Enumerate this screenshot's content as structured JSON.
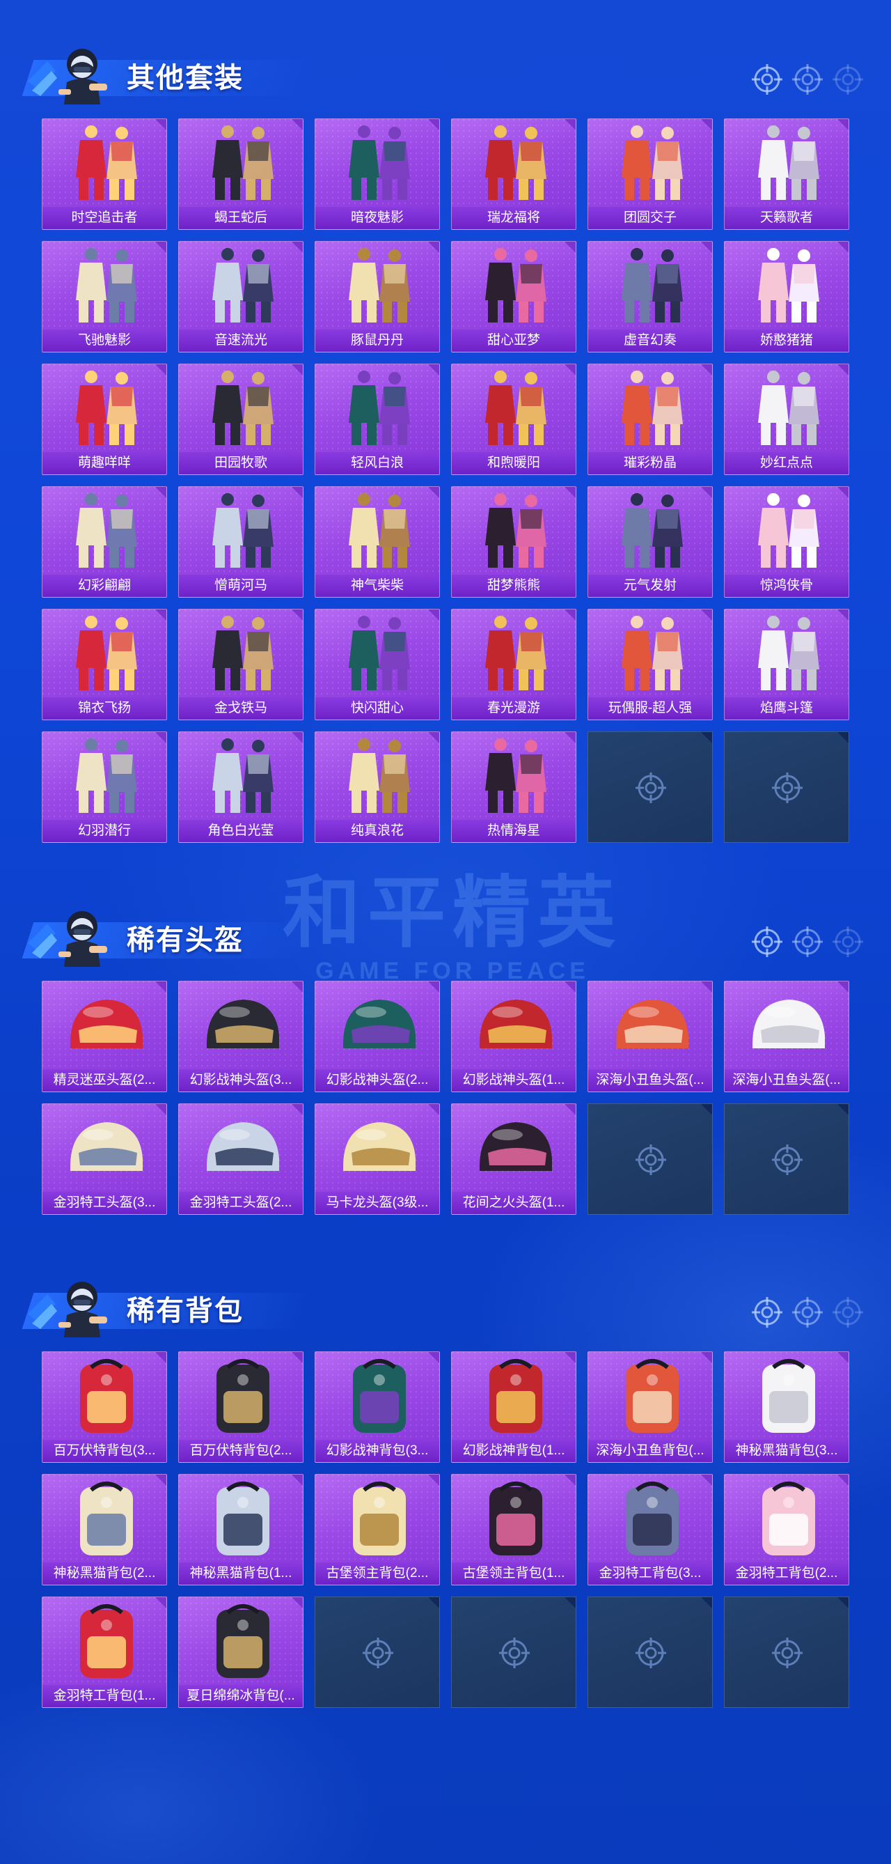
{
  "colors": {
    "background": "#1148d4",
    "card_purple": "#9a48e6",
    "card_label": "#7a2fd4",
    "empty_slot": "#1f3b66",
    "title_text": "#ffffff"
  },
  "watermark": {
    "title": "和平精英",
    "subtitle": "GAME FOR PEACE"
  },
  "sections": {
    "outfits": {
      "title": "其他套装",
      "items": [
        {
          "label": "时空追击者",
          "art": "red-armor-suit"
        },
        {
          "label": "蝎王蛇后",
          "art": "dark-gold-suits"
        },
        {
          "label": "暗夜魅影",
          "art": "teal-dark-suits"
        },
        {
          "label": "瑞龙福将",
          "art": "red-gold-suits"
        },
        {
          "label": "团圆交子",
          "art": "orange-red-dresses"
        },
        {
          "label": "天籁歌者",
          "art": "white-suits"
        },
        {
          "label": "飞驰魅影",
          "art": "gold-white-suits"
        },
        {
          "label": "音速流光",
          "art": "silver-jacket-suits"
        },
        {
          "label": "豚鼠丹丹",
          "art": "cream-costume"
        },
        {
          "label": "甜心亚梦",
          "art": "pink-black-outfit"
        },
        {
          "label": "虚音幻奏",
          "art": "gray-purple-suits"
        },
        {
          "label": "娇憨猪猪",
          "art": "pink-piggy-outfit"
        },
        {
          "label": "萌趣咩咩",
          "art": "blue-sheep-outfit"
        },
        {
          "label": "田园牧歌",
          "art": "yellow-pastoral-outfit"
        },
        {
          "label": "轻风白浪",
          "art": "white-breeze-outfit"
        },
        {
          "label": "和煦暖阳",
          "art": "white-pink-outfit"
        },
        {
          "label": "璀彩粉晶",
          "art": "pink-crystal-outfit"
        },
        {
          "label": "妙红点点",
          "art": "red-dot-dress"
        },
        {
          "label": "幻彩翩翩",
          "art": "rainbow-outfit"
        },
        {
          "label": "憎萌河马",
          "art": "mint-hippo-outfit"
        },
        {
          "label": "神气柴柴",
          "art": "orange-shiba-outfit"
        },
        {
          "label": "甜梦熊熊",
          "art": "blue-bear-outfit"
        },
        {
          "label": "元气发射",
          "art": "white-sport-outfit"
        },
        {
          "label": "惊鸿侠骨",
          "art": "dark-red-robes"
        },
        {
          "label": "锦衣飞扬",
          "art": "white-blue-robes"
        },
        {
          "label": "金戈铁马",
          "art": "black-gold-robes"
        },
        {
          "label": "快闪甜心",
          "art": "black-pink-heart-outfit"
        },
        {
          "label": "春光漫游",
          "art": "black-pink-jacket"
        },
        {
          "label": "玩偶服-超人强",
          "art": "superhero-mascot-suits"
        },
        {
          "label": "焰鹰斗篷",
          "art": "black-red-cloak"
        },
        {
          "label": "幻羽潜行",
          "art": "black-stealth-suits"
        },
        {
          "label": "角色白光莹",
          "art": "character-figure"
        },
        {
          "label": "纯真浪花",
          "art": "white-yellow-wave-outfit"
        },
        {
          "label": "热情海星",
          "art": "blue-starfish-outfit"
        }
      ],
      "empty_slots": 2
    },
    "helmets": {
      "title": "稀有头盔",
      "items": [
        {
          "label": "精灵迷巫头盔(2...",
          "art": "gold-winged-helmet"
        },
        {
          "label": "幻影战神头盔(3...",
          "art": "white-purple-helmet"
        },
        {
          "label": "幻影战神头盔(2...",
          "art": "black-star-helmet"
        },
        {
          "label": "幻影战神头盔(1...",
          "art": "black-white-helmet"
        },
        {
          "label": "深海小丑鱼头盔(...",
          "art": "teal-clownfish-helmet"
        },
        {
          "label": "深海小丑鱼头盔(...",
          "art": "dark-teal-helmet"
        },
        {
          "label": "金羽特工头盔(3...",
          "art": "black-gold-helmet-3"
        },
        {
          "label": "金羽特工头盔(2...",
          "art": "black-gold-helmet-2"
        },
        {
          "label": "马卡龙头盔(3级...",
          "art": "pink-macaron-helmet"
        },
        {
          "label": "花间之火头盔(1...",
          "art": "pink-sparkle-helmet"
        }
      ],
      "empty_slots": 2
    },
    "backpacks": {
      "title": "稀有背包",
      "items": [
        {
          "label": "百万伏特背包(3...",
          "art": "white-cat-backpack"
        },
        {
          "label": "百万伏特背包(2...",
          "art": "gray-cat-backpack"
        },
        {
          "label": "幻影战神背包(3...",
          "art": "white-purple-backpack"
        },
        {
          "label": "幻影战神背包(1...",
          "art": "gray-backpack"
        },
        {
          "label": "深海小丑鱼背包(...",
          "art": "clownfish-backpack"
        },
        {
          "label": "神秘黑猫背包(3...",
          "art": "black-cat-backpack-3"
        },
        {
          "label": "神秘黑猫背包(2...",
          "art": "black-cat-backpack-2"
        },
        {
          "label": "神秘黑猫背包(1...",
          "art": "black-cat-backpack-1"
        },
        {
          "label": "古堡领主背包(2...",
          "art": "purple-castle-backpack"
        },
        {
          "label": "古堡领主背包(1...",
          "art": "dark-castle-backpack"
        },
        {
          "label": "金羽特工背包(3...",
          "art": "black-gold-backpack-3"
        },
        {
          "label": "金羽特工背包(2...",
          "art": "black-gold-backpack-2"
        },
        {
          "label": "金羽特工背包(1...",
          "art": "black-gold-backpack-1"
        },
        {
          "label": "夏日绵绵冰背包(...",
          "art": "ice-cream-backpack"
        }
      ],
      "empty_slots": 4
    }
  }
}
